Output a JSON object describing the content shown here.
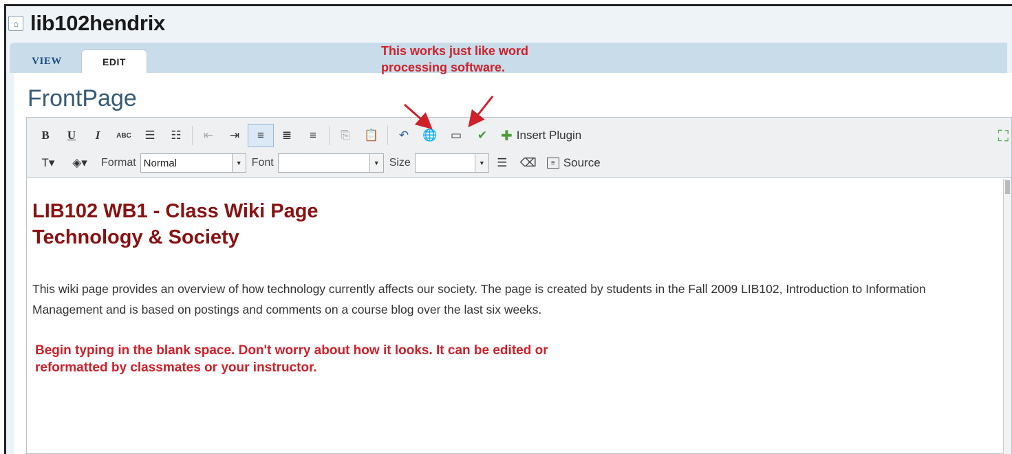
{
  "site": {
    "title": "lib102hendrix",
    "home_icon": "home-icon"
  },
  "tabs": [
    {
      "label": "VIEW",
      "active": false
    },
    {
      "label": "EDIT",
      "active": true
    }
  ],
  "page": {
    "name": "FrontPage"
  },
  "annotations": {
    "top": "This works just like word processing software.",
    "middle": "Begin typing in the blank space.  Don't worry about how it looks.  It can be edited or reformatted by classmates or your instructor.",
    "color": "#d0202a"
  },
  "toolbar": {
    "bold": "B",
    "underline": "U",
    "italic": "I",
    "strike": "ABC",
    "insert_plugin": "Insert Plugin",
    "format_label": "Format",
    "format_value": "Normal",
    "font_label": "Font",
    "font_value": "",
    "size_label": "Size",
    "size_value": "",
    "source_label": "Source"
  },
  "document": {
    "heading_line1": "LIB102 WB1 - Class Wiki Page",
    "heading_line2": "Technology & Society",
    "heading_color": "#8a1111",
    "paragraph": "This wiki page provides an overview of how technology currently affects our society.  The page is created by students in the Fall 2009 LIB102, Introduction to Information Management and is based on postings and comments on a course blog over the last six weeks."
  }
}
